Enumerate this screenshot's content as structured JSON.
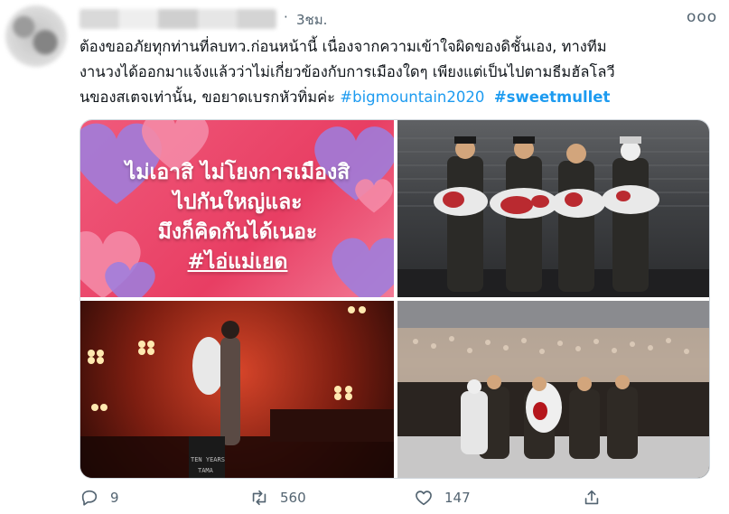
{
  "tweet": {
    "time": "3ชม.",
    "separator": "·",
    "more": "ooo",
    "text_lines": [
      "ต้องขออภัยทุกท่านที่ลบทว.ก่อนหน้านี้ เนื่องจากความเข้าใจผิดของดิชั้นเอง, ทางทีม",
      "งานวงได้ออกมาแจ้งแล้วว่าไม่เกี่ยวข้องกับการเมืองใดๆ เพียงแต่เป็นไปตามธีมฮัลโลวี",
      "นของสเตจเท่านั้น, ขอยาดเบรกหัวทิ่มค่ะ "
    ],
    "hashtag_1": "#bigmountain2020",
    "hashtag_2": "#sweetmullet"
  },
  "media": {
    "image_1": {
      "lines": [
        "ไม่เอาสิ ไม่โยงการเมืองสิ",
        "ไปกันใหญ่และ",
        "มึงก็คิดกันได้เนอะ"
      ],
      "tag": "#ไอ่แม่เยด",
      "colors": {
        "bg": "#e83e63",
        "heart_pink": "#f48aa6",
        "heart_purple": "#9b7fe0"
      }
    },
    "image_3": {
      "monitor_text": "TEN YEARS\nTAMA"
    }
  },
  "actions": {
    "reply_count": "9",
    "retweet_count": "560",
    "like_count": "147"
  },
  "icons": [
    "reply-icon",
    "retweet-icon",
    "like-icon",
    "share-icon"
  ]
}
